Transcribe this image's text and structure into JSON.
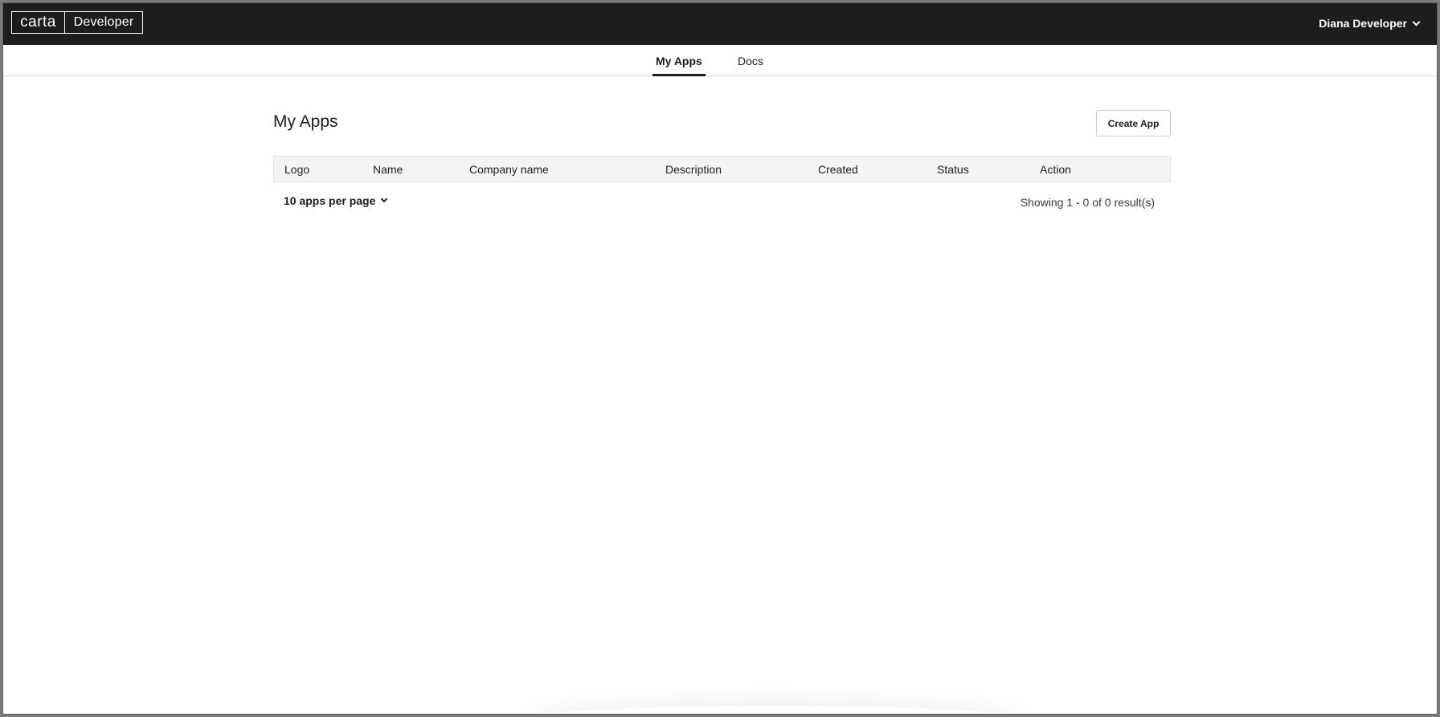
{
  "brand": {
    "logo_word": "carta",
    "logo_suffix": "Developer"
  },
  "user": {
    "name": "Diana Developer",
    "menu_icon": "chevron-down-icon"
  },
  "nav": {
    "tabs": [
      {
        "label": "My Apps",
        "active": true
      },
      {
        "label": "Docs",
        "active": false
      }
    ]
  },
  "main": {
    "title": "My Apps",
    "create_button": "Create App",
    "table": {
      "columns": [
        "Logo",
        "Name",
        "Company name",
        "Description",
        "Created",
        "Status",
        "Action"
      ],
      "rows": []
    },
    "per_page_label": "10 apps per page",
    "results_text": "Showing 1 - 0 of 0 result(s)"
  },
  "colors": {
    "header_bg": "#1f1d1c",
    "table_head_bg": "#f4f4f4",
    "text": "#1f1d1c"
  }
}
